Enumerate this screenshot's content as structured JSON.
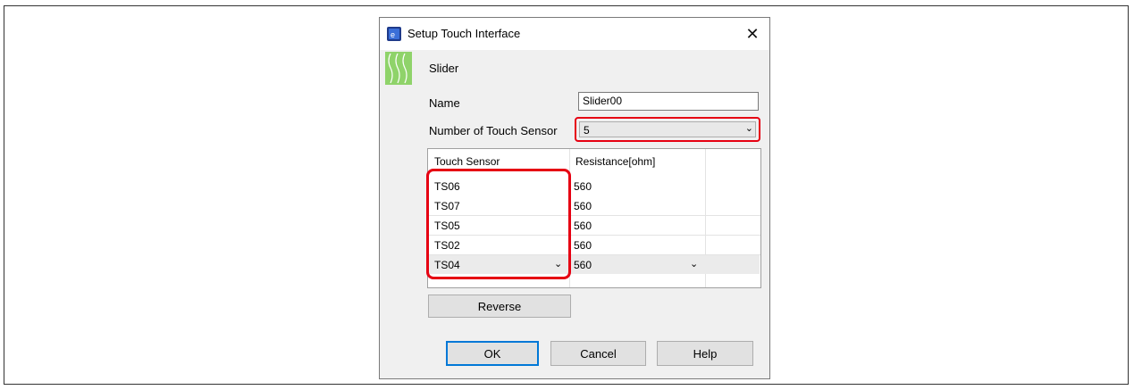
{
  "dialog": {
    "title": "Setup Touch Interface",
    "close_glyph": "✕",
    "section_title": "Slider",
    "name_label": "Name",
    "name_value": "Slider00",
    "count_label": "Number of Touch Sensor",
    "count_value": "5"
  },
  "table": {
    "headers": [
      "Touch Sensor",
      "Resistance[ohm]"
    ],
    "rows": [
      {
        "sensor": "TS06",
        "resistance": "560"
      },
      {
        "sensor": "TS07",
        "resistance": "560"
      },
      {
        "sensor": "TS05",
        "resistance": "560"
      },
      {
        "sensor": "TS02",
        "resistance": "560"
      },
      {
        "sensor": "TS04",
        "resistance": "560"
      }
    ]
  },
  "buttons": {
    "reverse": "Reverse",
    "ok": "OK",
    "cancel": "Cancel",
    "help": "Help"
  },
  "colors": {
    "highlight": "#e60012",
    "focus": "#0078d7",
    "slider_icon": "#8fd36a"
  }
}
